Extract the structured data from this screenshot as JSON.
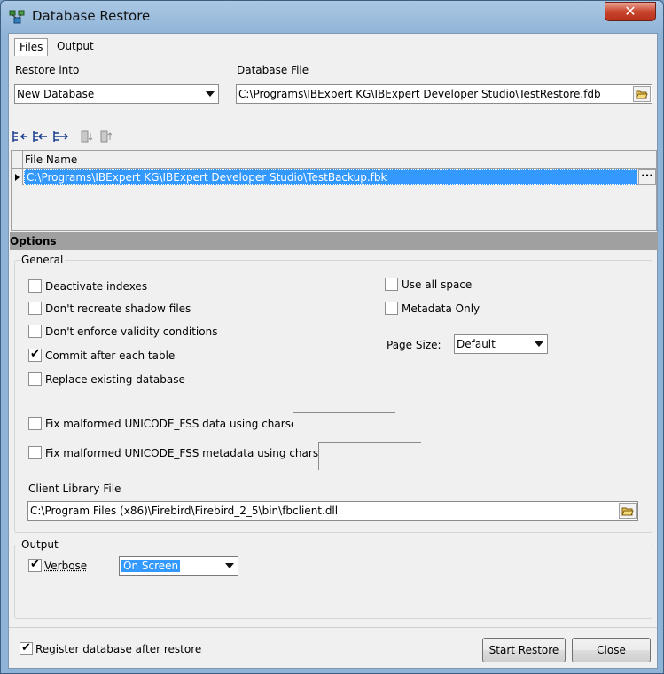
{
  "window": {
    "title": "Database Restore",
    "close_glyph": "✕"
  },
  "tabs": [
    {
      "label": "Files"
    },
    {
      "label": "Output"
    }
  ],
  "restore_into": {
    "label": "Restore into",
    "value": "New Database"
  },
  "database_file": {
    "label": "Database File",
    "value": "C:\\Programs\\IBExpert KG\\IBExpert Developer Studio\\TestRestore.fdb"
  },
  "toolbar": {
    "icons": [
      "insert-file-icon",
      "add-file-icon",
      "append-file-icon",
      "move-down-icon",
      "move-up-icon"
    ]
  },
  "files_grid": {
    "column_header": "File Name",
    "rows": [
      {
        "file_name": "C:\\Programs\\IBExpert KG\\IBExpert Developer Studio\\TestBackup.fbk"
      }
    ],
    "ellipsis": "···"
  },
  "options": {
    "section_title": "Options",
    "general": {
      "title": "General",
      "checkboxes": [
        {
          "label": "Deactivate indexes",
          "checked": false
        },
        {
          "label": "Don't recreate shadow files",
          "checked": false
        },
        {
          "label": "Don't enforce validity conditions",
          "checked": false
        },
        {
          "label": "Commit after each table",
          "checked": true
        },
        {
          "label": "Replace existing database",
          "checked": false
        }
      ],
      "right_checkboxes": [
        {
          "label": "Use all space",
          "checked": false
        },
        {
          "label": "Metadata Only",
          "checked": false
        }
      ],
      "page_size": {
        "label": "Page Size:",
        "value": "Default"
      },
      "fix_data": {
        "label": "Fix malformed UNICODE_FSS data using charset",
        "checked": false
      },
      "fix_metadata": {
        "label": "Fix malformed UNICODE_FSS metadata using charset",
        "checked": false
      },
      "client_library": {
        "label": "Client Library File",
        "value": "C:\\Program Files (x86)\\Firebird\\Firebird_2_5\\bin\\fbclient.dll"
      }
    },
    "output": {
      "title": "Output",
      "verbose": {
        "label": "Verbose",
        "checked": true
      },
      "verbose_target": "On Screen"
    }
  },
  "footer": {
    "register": {
      "label": "Register database after restore",
      "checked": true
    },
    "start_button": "Start Restore",
    "close_button": "Close"
  },
  "check_glyph": "✔"
}
